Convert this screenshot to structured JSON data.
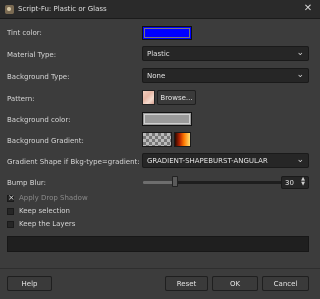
{
  "window": {
    "title": "Script-Fu: Plastic or Glass"
  },
  "fields": {
    "tint_color_label": "Tint color:",
    "tint_color_value": "#0000ff",
    "material_type_label": "Material Type:",
    "material_type_value": "Plastic",
    "background_type_label": "Background Type:",
    "background_type_value": "None",
    "pattern_label": "Pattern:",
    "pattern_browse_label": "Browse...",
    "background_color_label": "Background color:",
    "background_color_value": "#9a9a9a",
    "background_gradient_label": "Background Gradient:",
    "gradient_shape_label": "Gradient Shape if Bkg-type=gradient:",
    "gradient_shape_value": "GRADIENT-SHAPEBURST-ANGULAR",
    "bump_blur_label": "Bump Blur:",
    "bump_blur_value": "30",
    "bump_blur_level": 0.2,
    "apply_drop_shadow_label": "Apply Drop Shadow",
    "apply_drop_shadow_checked": true,
    "keep_selection_label": "Keep selection",
    "keep_selection_checked": false,
    "keep_layers_label": "Keep the Layers",
    "keep_layers_checked": false
  },
  "buttons": {
    "help": "Help",
    "reset": "Reset",
    "ok": "OK",
    "cancel": "Cancel"
  },
  "icons": {
    "app": "gimp-icon",
    "close": "close-icon",
    "dropdown": "chevron-down-icon"
  }
}
